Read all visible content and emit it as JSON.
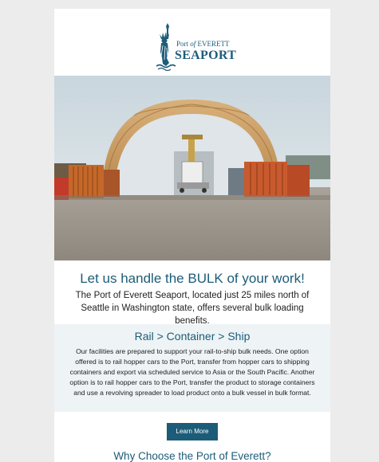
{
  "logo": {
    "line1_prefix": "Port",
    "line1_of": "of",
    "line1_suffix": "EVERETT",
    "line2": "SEAPORT",
    "icon": "statue-of-liberty-icon"
  },
  "hero": {
    "headline": "Let us handle the BULK of your work!",
    "intro": "The Port of Everett Seaport, located just 25 miles north of Seattle in Washington state, offers several bulk loading benefits."
  },
  "rail": {
    "title": "Rail > Container > Ship",
    "body": "Our facilities are prepared to support your rail-to-ship bulk needs. One option offered is to rail hopper cars to the Port, transfer from hopper cars to shipping containers and export via scheduled service to Asia or the South Pacific. Another option is to rail hopper cars to the Port, transfer the product to storage containers and use a revolving spreader to load product onto a bulk vessel in bulk format."
  },
  "cta": {
    "label": "Learn More"
  },
  "why": {
    "title": "Why Choose the Port of Everett?"
  },
  "colors": {
    "brand": "#1c5c78",
    "page_bg": "#ececec",
    "section_bg": "#eef3f6"
  }
}
